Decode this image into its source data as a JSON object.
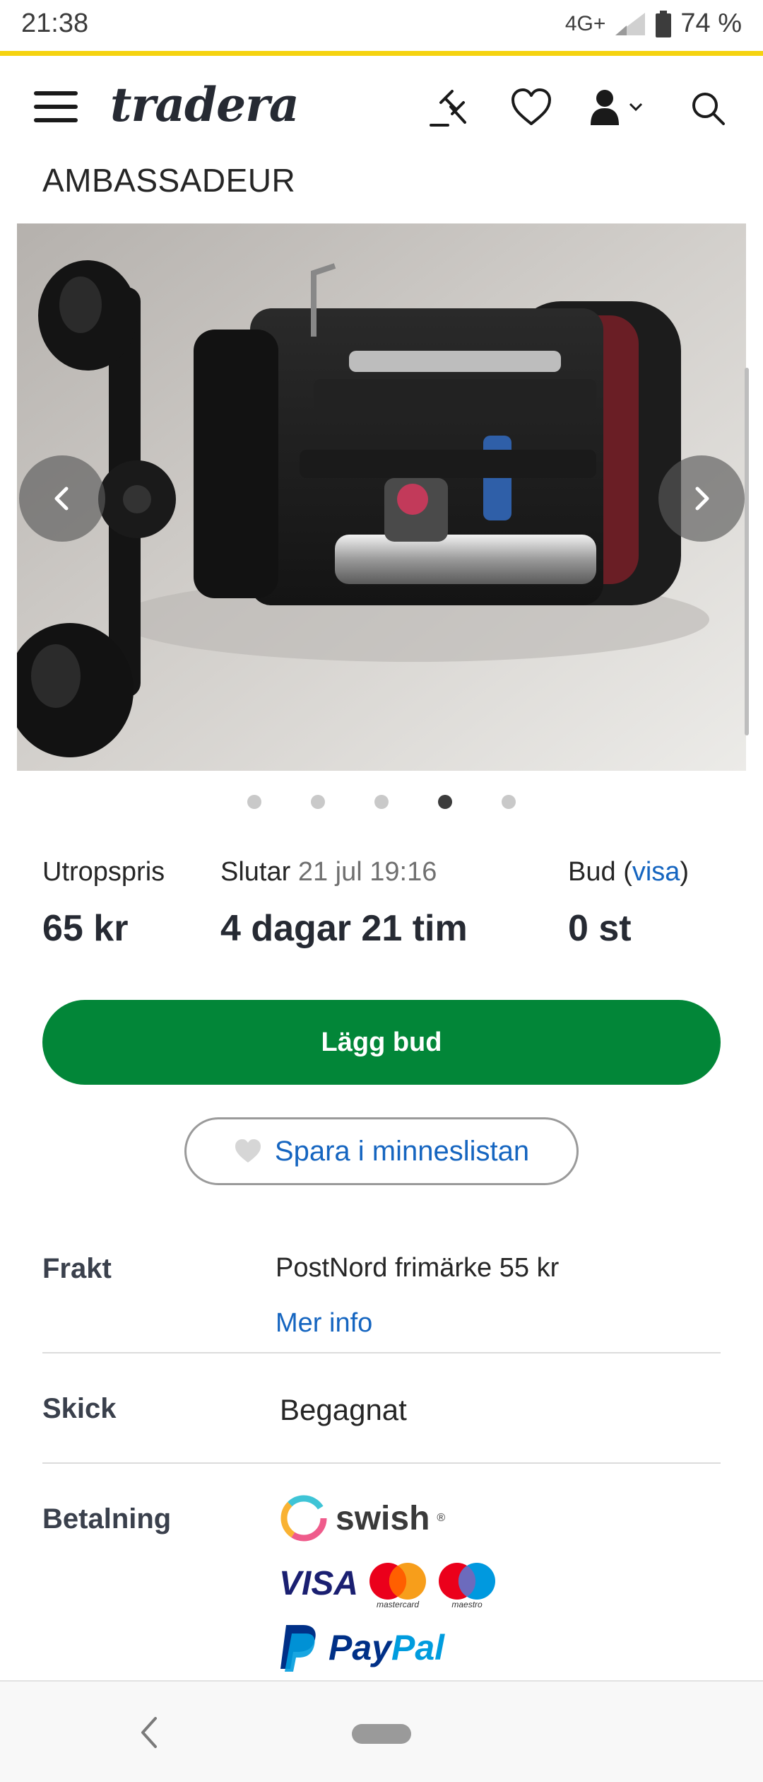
{
  "status_bar": {
    "time": "21:38",
    "network": "4G+",
    "battery": "74 %"
  },
  "header": {
    "logo": "tradera"
  },
  "listing": {
    "title": "AMBASSADEUR"
  },
  "gallery": {
    "image_count": 5,
    "active_index": 3
  },
  "info": {
    "start_price_label": "Utropspris",
    "start_price_value": "65 kr",
    "ends_label": "Slutar",
    "ends_date": "21 jul 19:16",
    "ends_value": "4 dagar 21 tim",
    "bids_label": "Bud",
    "bids_open": "(",
    "bids_link": "visa",
    "bids_close": ")",
    "bids_value": "0 st"
  },
  "actions": {
    "bid_button": "Lägg bud",
    "save_button": "Spara i minneslistan"
  },
  "details": {
    "shipping_label": "Frakt",
    "shipping_value": "PostNord frimärke 55 kr",
    "shipping_link": "Mer info",
    "condition_label": "Skick",
    "condition_value": "Begagnat",
    "payment_label": "Betalning",
    "payment_methods": {
      "swish": "swish",
      "swish_reg": "®",
      "visa": "VISA",
      "mastercard": "mastercard",
      "maestro": "maestro",
      "paypal_pay": "Pay",
      "paypal_pal": "Pal"
    }
  },
  "colors": {
    "accent_yellow": "#f5d310",
    "bid_green": "#028638",
    "link_blue": "#1565c0"
  }
}
